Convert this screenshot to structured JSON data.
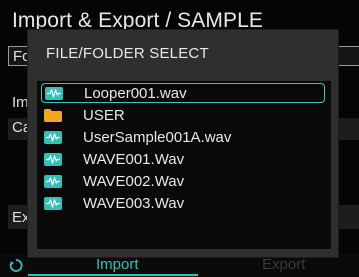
{
  "background": {
    "title": "Import & Export / SAMPLE",
    "field1_label": "Fc",
    "label1": "Im",
    "field2_label": "Ca",
    "field3_label": "Ex"
  },
  "tabs": {
    "import_label": "Import",
    "export_label": "Export"
  },
  "dialog": {
    "title": "FILE/FOLDER SELECT",
    "items": [
      {
        "label": "Looper001.wav",
        "icon": "wave-file-icon",
        "selected": true
      },
      {
        "label": "USER",
        "icon": "folder-icon",
        "selected": false
      },
      {
        "label": "UserSample001A.wav",
        "icon": "wave-file-icon",
        "selected": false
      },
      {
        "label": "WAVE001.Wav",
        "icon": "wave-file-icon",
        "selected": false
      },
      {
        "label": "WAVE002.Wav",
        "icon": "wave-file-icon",
        "selected": false
      },
      {
        "label": "WAVE003.Wav",
        "icon": "wave-file-icon",
        "selected": false
      }
    ]
  },
  "colors": {
    "accent": "#2ec2b9",
    "folder": "#f3a51c",
    "dialog_bg": "#2f2f2f",
    "list_bg": "#090909"
  }
}
